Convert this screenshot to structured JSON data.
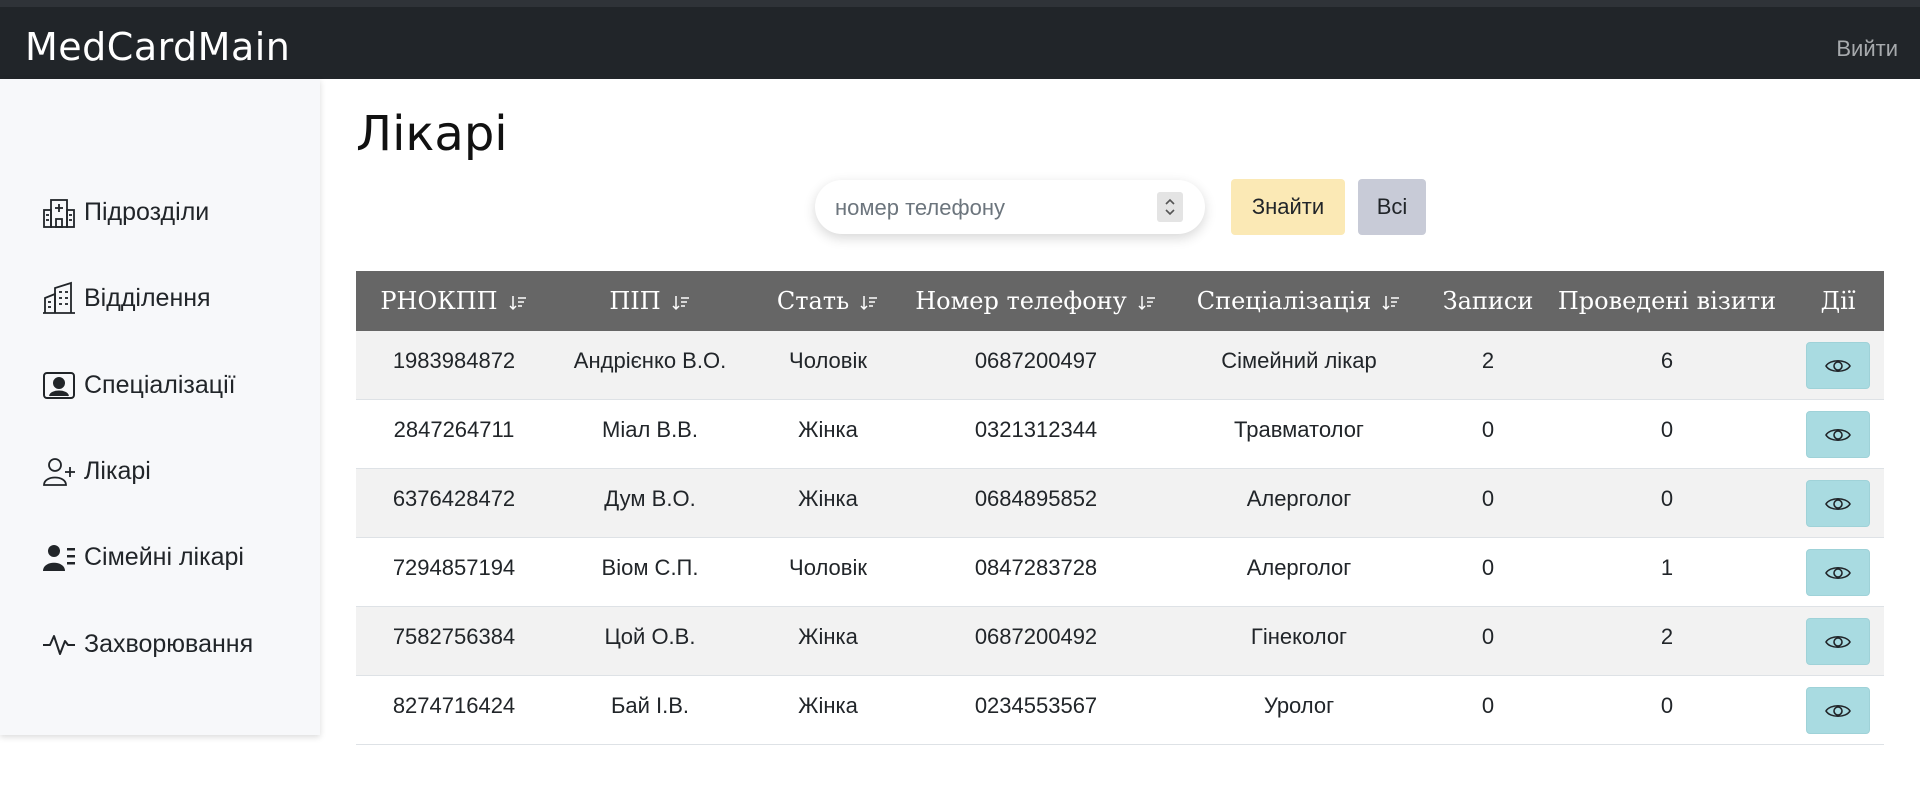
{
  "navbar": {
    "brand": "MedCardMain",
    "logout_label": "Вийти"
  },
  "sidebar": {
    "items": [
      {
        "label": "Підрозділи",
        "icon": "hospital-icon"
      },
      {
        "label": "Відділення",
        "icon": "buildings-icon"
      },
      {
        "label": "Спеціалізації",
        "icon": "person-badge-icon"
      },
      {
        "label": "Лікарі",
        "icon": "person-plus-icon"
      },
      {
        "label": "Сімейні лікарі",
        "icon": "person-lines-icon"
      },
      {
        "label": "Захворювання",
        "icon": "activity-icon"
      }
    ]
  },
  "main": {
    "title": "Лікарі",
    "search": {
      "placeholder": "номер телефону",
      "value": ""
    },
    "find_label": "Знайти",
    "all_label": "Всі"
  },
  "table": {
    "columns": [
      {
        "label": "РНОКПП",
        "sortable": true
      },
      {
        "label": "ПІП",
        "sortable": true
      },
      {
        "label": "Стать",
        "sortable": true
      },
      {
        "label": "Номер телефону",
        "sortable": true
      },
      {
        "label": "Спеціалізація",
        "sortable": true
      },
      {
        "label": "Записи",
        "sortable": false
      },
      {
        "label": "Проведені візити",
        "sortable": false
      },
      {
        "label": "Дії",
        "sortable": false
      }
    ],
    "rows": [
      {
        "rnokpp": "1983984872",
        "pib": "Андрієнко В.О.",
        "sex": "Чоловік",
        "phone": "0687200497",
        "spec": "Сімейний лікар",
        "records": "2",
        "visits": "6"
      },
      {
        "rnokpp": "2847264711",
        "pib": "Міал В.В.",
        "sex": "Жінка",
        "phone": "0321312344",
        "spec": "Травматолог",
        "records": "0",
        "visits": "0"
      },
      {
        "rnokpp": "6376428472",
        "pib": "Дум В.О.",
        "sex": "Жінка",
        "phone": "0684895852",
        "spec": "Алерголог",
        "records": "0",
        "visits": "0"
      },
      {
        "rnokpp": "7294857194",
        "pib": "Віом С.П.",
        "sex": "Чоловік",
        "phone": "0847283728",
        "spec": "Алерголог",
        "records": "0",
        "visits": "1"
      },
      {
        "rnokpp": "7582756384",
        "pib": "Цой О.В.",
        "sex": "Жінка",
        "phone": "0687200492",
        "spec": "Гінеколог",
        "records": "0",
        "visits": "2"
      },
      {
        "rnokpp": "8274716424",
        "pib": "Бай І.В.",
        "sex": "Жінка",
        "phone": "0234553567",
        "spec": "Уролог",
        "records": "0",
        "visits": "0"
      }
    ],
    "action_icon": "eye-icon"
  },
  "colors": {
    "navbar_bg": "#212529",
    "sidebar_bg": "#f7f8fa",
    "table_header_bg": "#666666",
    "find_button_bg": "#fbe9b5",
    "all_button_bg": "#c8cbd7",
    "view_button_bg": "#a9dbe1"
  }
}
